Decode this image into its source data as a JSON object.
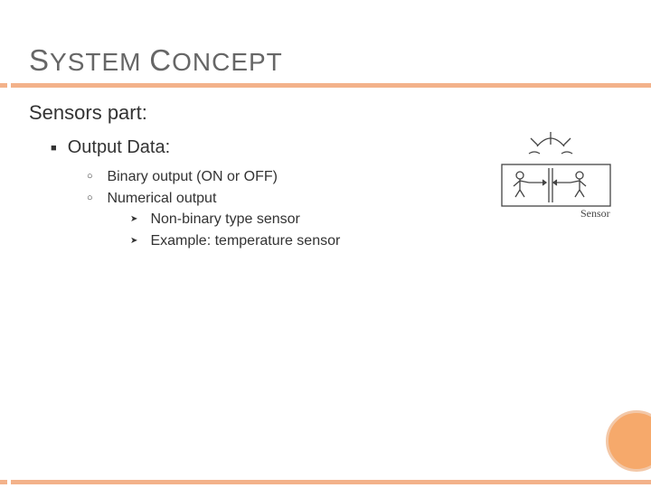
{
  "title_parts": {
    "p1": "S",
    "p2": "YSTEM ",
    "p3": "C",
    "p4": "ONCEPT"
  },
  "subheading": "Sensors part:",
  "outline": {
    "l1": "Output Data:",
    "l2a": "Binary output (ON or OFF)",
    "l2b": "Numerical output",
    "l3a": "Non-binary type sensor",
    "l3b": "Example: temperature sensor"
  },
  "illustration_caption": "Sensor"
}
